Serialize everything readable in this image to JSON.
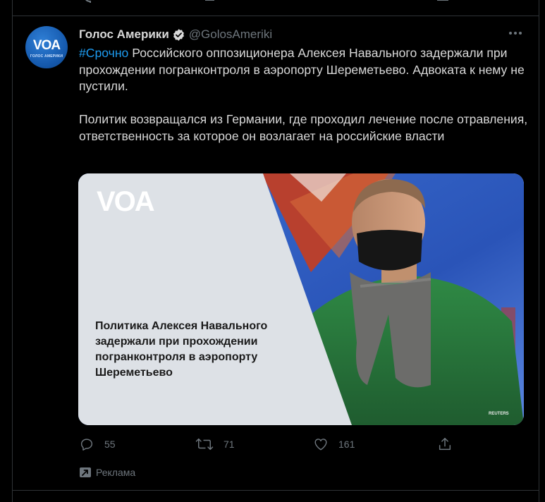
{
  "tweet": {
    "display_name": "Голос Америки",
    "handle": "@GolosAmeriki",
    "verified": true,
    "avatar": {
      "logo_text": "VOA",
      "sub_text": "ГОЛОС АМЕРИКИ"
    },
    "hashtag": "#Срочно",
    "text_p1": " Российского оппозиционера Алексея Навального задержали при прохождении погранконтроля в аэропорту Шереметьево. Адвоката к нему не пустили.",
    "text_p2": "Политик возвращался из Германии, где проходил лечение после отравления, ответственность за которое он возлагает на российские власти",
    "media": {
      "logo_text": "VOA",
      "headline": "Политика Алексея Навального задержали при прохождении погранконтроля в аэропорту Шереметьево",
      "credit": "REUTERS"
    },
    "actions": {
      "replies": "55",
      "retweets": "71",
      "likes": "161"
    },
    "promoted_label": "Реклама"
  },
  "colors": {
    "background": "#000000",
    "text": "#d9d9d9",
    "muted": "#6e767d",
    "accent": "#1d9bf0",
    "border": "#2f3336"
  },
  "icons": [
    "reply-icon",
    "retweet-icon",
    "like-icon",
    "share-icon",
    "more-icon",
    "verified-icon",
    "promoted-icon"
  ]
}
